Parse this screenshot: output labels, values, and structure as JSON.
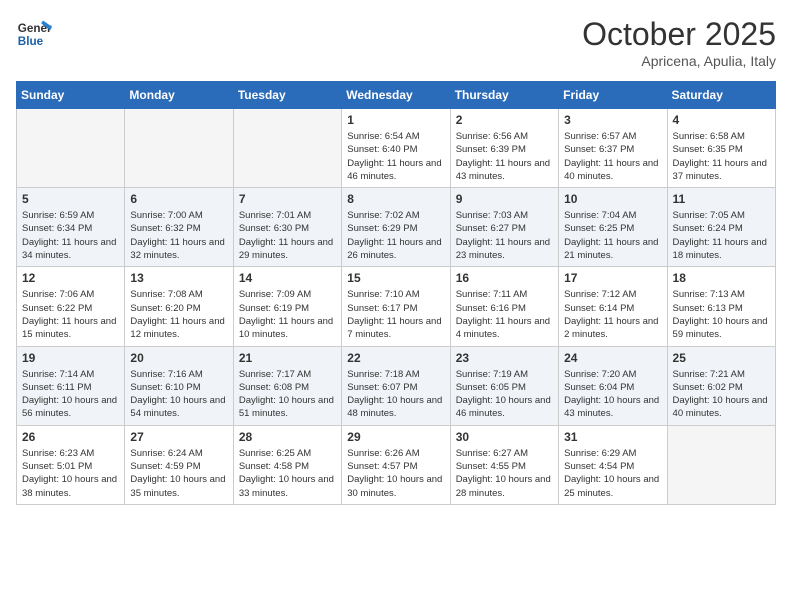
{
  "header": {
    "logo_line1": "General",
    "logo_line2": "Blue",
    "month": "October 2025",
    "location": "Apricena, Apulia, Italy"
  },
  "weekdays": [
    "Sunday",
    "Monday",
    "Tuesday",
    "Wednesday",
    "Thursday",
    "Friday",
    "Saturday"
  ],
  "weeks": [
    [
      {
        "day": "",
        "info": ""
      },
      {
        "day": "",
        "info": ""
      },
      {
        "day": "",
        "info": ""
      },
      {
        "day": "1",
        "info": "Sunrise: 6:54 AM\nSunset: 6:40 PM\nDaylight: 11 hours and 46 minutes."
      },
      {
        "day": "2",
        "info": "Sunrise: 6:56 AM\nSunset: 6:39 PM\nDaylight: 11 hours and 43 minutes."
      },
      {
        "day": "3",
        "info": "Sunrise: 6:57 AM\nSunset: 6:37 PM\nDaylight: 11 hours and 40 minutes."
      },
      {
        "day": "4",
        "info": "Sunrise: 6:58 AM\nSunset: 6:35 PM\nDaylight: 11 hours and 37 minutes."
      }
    ],
    [
      {
        "day": "5",
        "info": "Sunrise: 6:59 AM\nSunset: 6:34 PM\nDaylight: 11 hours and 34 minutes."
      },
      {
        "day": "6",
        "info": "Sunrise: 7:00 AM\nSunset: 6:32 PM\nDaylight: 11 hours and 32 minutes."
      },
      {
        "day": "7",
        "info": "Sunrise: 7:01 AM\nSunset: 6:30 PM\nDaylight: 11 hours and 29 minutes."
      },
      {
        "day": "8",
        "info": "Sunrise: 7:02 AM\nSunset: 6:29 PM\nDaylight: 11 hours and 26 minutes."
      },
      {
        "day": "9",
        "info": "Sunrise: 7:03 AM\nSunset: 6:27 PM\nDaylight: 11 hours and 23 minutes."
      },
      {
        "day": "10",
        "info": "Sunrise: 7:04 AM\nSunset: 6:25 PM\nDaylight: 11 hours and 21 minutes."
      },
      {
        "day": "11",
        "info": "Sunrise: 7:05 AM\nSunset: 6:24 PM\nDaylight: 11 hours and 18 minutes."
      }
    ],
    [
      {
        "day": "12",
        "info": "Sunrise: 7:06 AM\nSunset: 6:22 PM\nDaylight: 11 hours and 15 minutes."
      },
      {
        "day": "13",
        "info": "Sunrise: 7:08 AM\nSunset: 6:20 PM\nDaylight: 11 hours and 12 minutes."
      },
      {
        "day": "14",
        "info": "Sunrise: 7:09 AM\nSunset: 6:19 PM\nDaylight: 11 hours and 10 minutes."
      },
      {
        "day": "15",
        "info": "Sunrise: 7:10 AM\nSunset: 6:17 PM\nDaylight: 11 hours and 7 minutes."
      },
      {
        "day": "16",
        "info": "Sunrise: 7:11 AM\nSunset: 6:16 PM\nDaylight: 11 hours and 4 minutes."
      },
      {
        "day": "17",
        "info": "Sunrise: 7:12 AM\nSunset: 6:14 PM\nDaylight: 11 hours and 2 minutes."
      },
      {
        "day": "18",
        "info": "Sunrise: 7:13 AM\nSunset: 6:13 PM\nDaylight: 10 hours and 59 minutes."
      }
    ],
    [
      {
        "day": "19",
        "info": "Sunrise: 7:14 AM\nSunset: 6:11 PM\nDaylight: 10 hours and 56 minutes."
      },
      {
        "day": "20",
        "info": "Sunrise: 7:16 AM\nSunset: 6:10 PM\nDaylight: 10 hours and 54 minutes."
      },
      {
        "day": "21",
        "info": "Sunrise: 7:17 AM\nSunset: 6:08 PM\nDaylight: 10 hours and 51 minutes."
      },
      {
        "day": "22",
        "info": "Sunrise: 7:18 AM\nSunset: 6:07 PM\nDaylight: 10 hours and 48 minutes."
      },
      {
        "day": "23",
        "info": "Sunrise: 7:19 AM\nSunset: 6:05 PM\nDaylight: 10 hours and 46 minutes."
      },
      {
        "day": "24",
        "info": "Sunrise: 7:20 AM\nSunset: 6:04 PM\nDaylight: 10 hours and 43 minutes."
      },
      {
        "day": "25",
        "info": "Sunrise: 7:21 AM\nSunset: 6:02 PM\nDaylight: 10 hours and 40 minutes."
      }
    ],
    [
      {
        "day": "26",
        "info": "Sunrise: 6:23 AM\nSunset: 5:01 PM\nDaylight: 10 hours and 38 minutes."
      },
      {
        "day": "27",
        "info": "Sunrise: 6:24 AM\nSunset: 4:59 PM\nDaylight: 10 hours and 35 minutes."
      },
      {
        "day": "28",
        "info": "Sunrise: 6:25 AM\nSunset: 4:58 PM\nDaylight: 10 hours and 33 minutes."
      },
      {
        "day": "29",
        "info": "Sunrise: 6:26 AM\nSunset: 4:57 PM\nDaylight: 10 hours and 30 minutes."
      },
      {
        "day": "30",
        "info": "Sunrise: 6:27 AM\nSunset: 4:55 PM\nDaylight: 10 hours and 28 minutes."
      },
      {
        "day": "31",
        "info": "Sunrise: 6:29 AM\nSunset: 4:54 PM\nDaylight: 10 hours and 25 minutes."
      },
      {
        "day": "",
        "info": ""
      }
    ]
  ]
}
